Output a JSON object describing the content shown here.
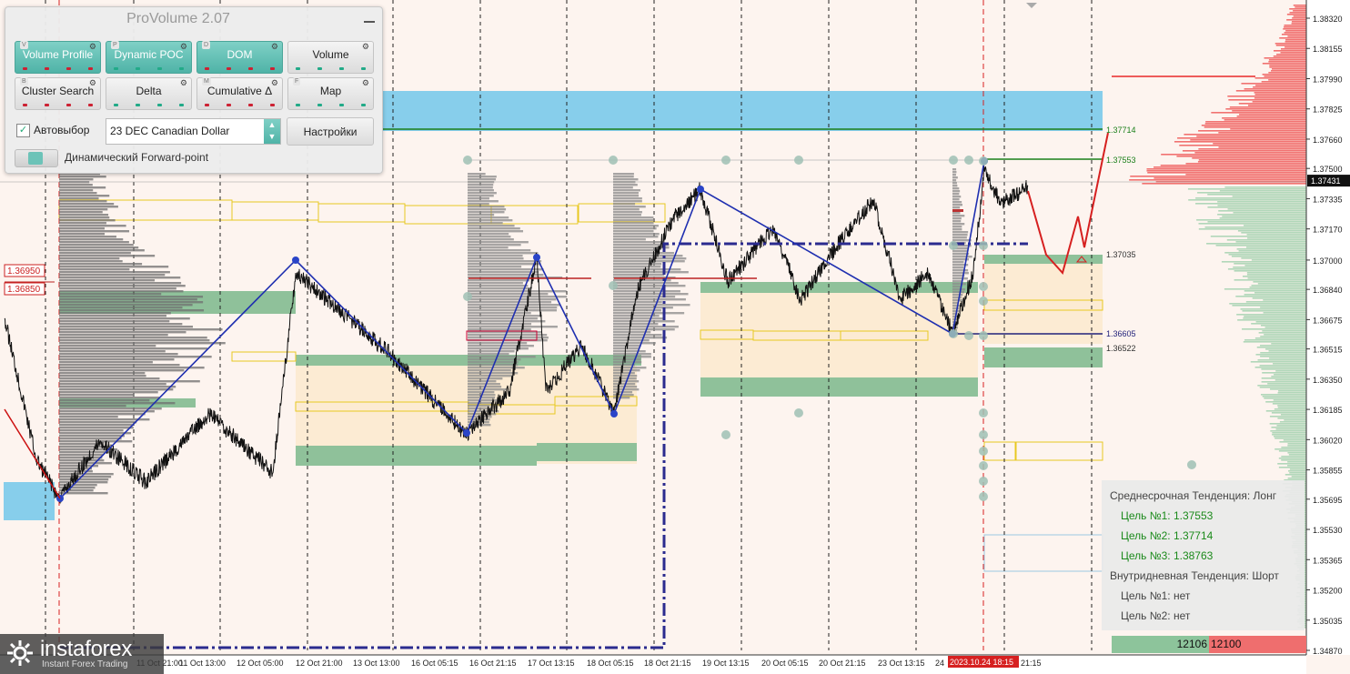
{
  "panel": {
    "title": "ProVolume 2.07",
    "buttons": [
      {
        "key": "V",
        "label": "Volume Profile",
        "on": true
      },
      {
        "key": "P",
        "label": "Dynamic POC",
        "on": true
      },
      {
        "key": "D",
        "label": "DOM",
        "on": true
      },
      {
        "key": "",
        "label": "Volume",
        "on": false
      },
      {
        "key": "B",
        "label": "Cluster Search",
        "on": false
      },
      {
        "key": "",
        "label": "Delta",
        "on": false
      },
      {
        "key": "M",
        "label": "Cumulative Δ",
        "on": false
      },
      {
        "key": "F",
        "label": "Map",
        "on": false
      }
    ],
    "autoselect_label": "Автовыбор",
    "autoselect_checked": true,
    "instrument": "23 DEC Canadian Dollar",
    "settings_label": "Настройки",
    "forward_point_label": "Динамический Forward-point"
  },
  "price_axis": {
    "labels": [
      "1.38320",
      "1.38155",
      "1.37990",
      "1.37825",
      "1.37660",
      "1.37500",
      "1.37335",
      "1.37170",
      "1.37000",
      "1.36840",
      "1.36675",
      "1.36515",
      "1.36350",
      "1.36185",
      "1.36020",
      "1.35855",
      "1.35695",
      "1.35530",
      "1.35365",
      "1.35200",
      "1.35035",
      "1.34870"
    ],
    "current_price": "1.37431"
  },
  "level_labels": {
    "l1": "1.37714",
    "l2": "1.37553",
    "l3": "1.37035",
    "l4": "1.36605",
    "l5": "1.36522"
  },
  "left_price_tags": [
    "1.36950",
    "1.36850"
  ],
  "time_axis": {
    "labels": [
      "11 Oct 21:00",
      "11 Oct 13:00",
      "12 Oct 05:00",
      "12 Oct 21:00",
      "13 Oct 13:00",
      "16 Oct 05:15",
      "16 Oct 21:15",
      "17 Oct 13:15",
      "18 Oct 05:15",
      "18 Oct 21:15",
      "19 Oct 13:15",
      "20 Oct 05:15",
      "20 Oct 21:15",
      "23 Oct 13:15",
      "24",
      "21:15"
    ],
    "highlight": "2023.10.24 18:15"
  },
  "info": {
    "mid_trend": "Среднесрочная Тенденция: Лонг",
    "mid_targets": [
      "Цель №1: 1.37553",
      "Цель №2: 1.37714",
      "Цель №3: 1.38763"
    ],
    "intraday_trend": "Внутридневная Тенденция: Шорт",
    "intraday_targets": [
      "Цель №1: нет",
      "Цель №2: нет"
    ]
  },
  "volume_box": {
    "buy": "12106",
    "sell": "12100"
  },
  "logo": {
    "name": "instaforex",
    "sub": "Instant Forex Trading"
  },
  "colors": {
    "background": "#fdf4ef",
    "zone_blue": "#87ceeb",
    "zone_green": "#8fc19a",
    "zone_beige": "#fcebd3",
    "zigzag": "#1f2fb0",
    "target_red": "#d62020",
    "level_green": "#1a7f1a",
    "profile_grey": "#8a8a8a"
  }
}
